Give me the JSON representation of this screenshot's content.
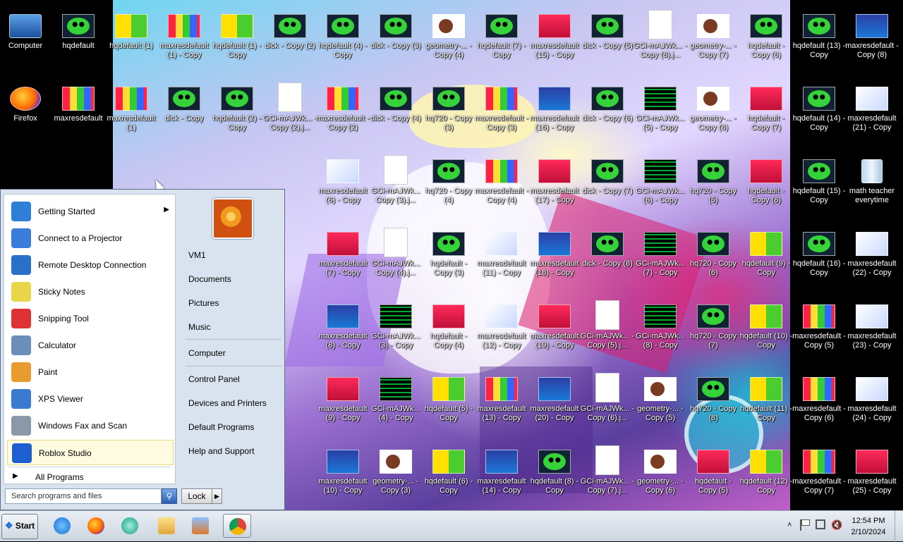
{
  "desktop_icons": [
    {
      "label": "Computer",
      "kind": "computer"
    },
    {
      "label": "hqdefault",
      "kind": "green"
    },
    {
      "label": "hqdefault (1)",
      "kind": "yellow"
    },
    {
      "label": "maxresdefault (1) - Copy",
      "kind": "multi"
    },
    {
      "label": "hqdefault (1) - Copy",
      "kind": "yellow"
    },
    {
      "label": "dick - Copy (2)",
      "kind": "green"
    },
    {
      "label": "hqdefault (4) - Copy",
      "kind": "green"
    },
    {
      "label": "dick - Copy (3)",
      "kind": "green"
    },
    {
      "label": "geometry-... - Copy (4)",
      "kind": "heart"
    },
    {
      "label": "hqdefault (7) - Copy",
      "kind": "green"
    },
    {
      "label": "maxresdefault (15) - Copy",
      "kind": "red"
    },
    {
      "label": "dick - Copy (5)",
      "kind": "green"
    },
    {
      "label": "GCi-mAJWk... - Copy (8).j...",
      "kind": "doc"
    },
    {
      "label": "geometry-... - Copy (7)",
      "kind": "heart"
    },
    {
      "label": "hqdefault - Copy (6)",
      "kind": "green"
    },
    {
      "label": "hqdefault (13) - Copy",
      "kind": "green"
    },
    {
      "label": "maxresdefault - Copy (8)",
      "kind": "blue"
    },
    {
      "label": "Firefox",
      "kind": "firefox"
    },
    {
      "label": "maxresdefault",
      "kind": "multi"
    },
    {
      "label": "maxresdefault (1)",
      "kind": "multi"
    },
    {
      "label": "dick - Copy",
      "kind": "green"
    },
    {
      "label": "hqdefault (2) - Copy",
      "kind": "green"
    },
    {
      "label": "GCi-mAJWk... - Copy (2).j...",
      "kind": "doc"
    },
    {
      "label": "maxresdefault - Copy (2)",
      "kind": "multi"
    },
    {
      "label": "dick - Copy (4)",
      "kind": "green"
    },
    {
      "label": "hq720 - Copy (3)",
      "kind": "green"
    },
    {
      "label": "maxresdefault - Copy (3)",
      "kind": "multi"
    },
    {
      "label": "maxresdefault (16) - Copy",
      "kind": "blue"
    },
    {
      "label": "dick - Copy (6)",
      "kind": "green"
    },
    {
      "label": "GCi-mAJWk... (5) - Copy",
      "kind": "dark"
    },
    {
      "label": "geometry-... - Copy (8)",
      "kind": "heart"
    },
    {
      "label": "hqdefault - Copy (7)",
      "kind": "red"
    },
    {
      "label": "hqdefault (14) - Copy",
      "kind": "green"
    },
    {
      "label": "maxresdefault (21) - Copy",
      "kind": "white"
    },
    {
      "label": "maxresdefault (6) - Copy",
      "kind": "white"
    },
    {
      "label": "GCi-mAJWk... Copy (3).j...",
      "kind": "doc"
    },
    {
      "label": "hq720 - Copy (4)",
      "kind": "green"
    },
    {
      "label": "maxresdefault - Copy (4)",
      "kind": "multi"
    },
    {
      "label": "maxresdefault (17) - Copy",
      "kind": "red"
    },
    {
      "label": "dick - Copy (7)",
      "kind": "green"
    },
    {
      "label": "GCi-mAJWk... (6) - Copy",
      "kind": "dark"
    },
    {
      "label": "hq720 - Copy (5)",
      "kind": "green"
    },
    {
      "label": "hqdefault - Copy (8)",
      "kind": "red"
    },
    {
      "label": "hqdefault (15) - Copy",
      "kind": "green"
    },
    {
      "label": "math teacher everytime",
      "kind": "recycle"
    },
    {
      "label": "maxresdefault (7) - Copy",
      "kind": "red"
    },
    {
      "label": "GCi-mAJWk... Copy (4).j...",
      "kind": "doc"
    },
    {
      "label": "hqdefault - Copy (3)",
      "kind": "green"
    },
    {
      "label": "maxresdefault (11) - Copy",
      "kind": "white"
    },
    {
      "label": "maxresdefault (18) - Copy",
      "kind": "blue"
    },
    {
      "label": "dick - Copy (8)",
      "kind": "green"
    },
    {
      "label": "GCi-mAJWk... (7) - Copy",
      "kind": "dark"
    },
    {
      "label": "hq720 - Copy (6)",
      "kind": "green"
    },
    {
      "label": "hqdefault (9) - Copy",
      "kind": "yellow"
    },
    {
      "label": "hqdefault (16) - Copy",
      "kind": "green"
    },
    {
      "label": "maxresdefault (22) - Copy",
      "kind": "white"
    },
    {
      "label": "maxresdefault (8) - Copy",
      "kind": "blue"
    },
    {
      "label": "GCi-mAJWk... (3) - Copy",
      "kind": "dark"
    },
    {
      "label": "hqdefault - Copy (4)",
      "kind": "red"
    },
    {
      "label": "maxresdefault (12) - Copy",
      "kind": "white"
    },
    {
      "label": "maxresdefault (19) - Copy",
      "kind": "red"
    },
    {
      "label": "GCi-mAJWk... - Copy (5).j...",
      "kind": "doc"
    },
    {
      "label": "GCi-mAJWk... (8) - Copy",
      "kind": "dark"
    },
    {
      "label": "hq720 - Copy (7)",
      "kind": "green"
    },
    {
      "label": "hqdefault (10) - Copy",
      "kind": "yellow"
    },
    {
      "label": "maxresdefault - Copy (5)",
      "kind": "multi"
    },
    {
      "label": "maxresdefault (23) - Copy",
      "kind": "white"
    },
    {
      "label": "maxresdefault (9) - Copy",
      "kind": "red"
    },
    {
      "label": "GCi-mAJWk... (4) - Copy",
      "kind": "dark"
    },
    {
      "label": "hqdefault (5) - Copy",
      "kind": "yellow"
    },
    {
      "label": "maxresdefault (13) - Copy",
      "kind": "multi"
    },
    {
      "label": "maxresdefault (20) - Copy",
      "kind": "blue"
    },
    {
      "label": "GCi-mAJWk... - Copy (6).j...",
      "kind": "doc"
    },
    {
      "label": "geometry-... - Copy (5)",
      "kind": "heart"
    },
    {
      "label": "hq720 - Copy (8)",
      "kind": "green"
    },
    {
      "label": "hqdefault (11) - Copy",
      "kind": "yellow"
    },
    {
      "label": "maxresdefault - Copy (6)",
      "kind": "multi"
    },
    {
      "label": "maxresdefault (24) - Copy",
      "kind": "white"
    },
    {
      "label": "maxresdefault (10) - Copy",
      "kind": "blue"
    },
    {
      "label": "geometry-... - Copy (3)",
      "kind": "heart"
    },
    {
      "label": "hqdefault (6) - Copy",
      "kind": "yellow"
    },
    {
      "label": "maxresdefault (14) - Copy",
      "kind": "blue"
    },
    {
      "label": "hqdefault (8) - Copy",
      "kind": "green"
    },
    {
      "label": "GCi-mAJWk... - Copy (7).j...",
      "kind": "doc"
    },
    {
      "label": "geometry-... - Copy (6)",
      "kind": "heart"
    },
    {
      "label": "hqdefault - Copy (5)",
      "kind": "red"
    },
    {
      "label": "hqdefault (12) - Copy",
      "kind": "yellow"
    },
    {
      "label": "maxresdefault - Copy (7)",
      "kind": "multi"
    },
    {
      "label": "maxresdefault (25) - Copy",
      "kind": "red"
    }
  ],
  "start_menu": {
    "programs": [
      {
        "label": "Getting Started",
        "icon": "getting-started-icon",
        "has_submenu": true
      },
      {
        "label": "Connect to a Projector",
        "icon": "projector-icon"
      },
      {
        "label": "Remote Desktop Connection",
        "icon": "remote-desktop-icon"
      },
      {
        "label": "Sticky Notes",
        "icon": "sticky-notes-icon"
      },
      {
        "label": "Snipping Tool",
        "icon": "snipping-tool-icon"
      },
      {
        "label": "Calculator",
        "icon": "calculator-icon"
      },
      {
        "label": "Paint",
        "icon": "paint-icon"
      },
      {
        "label": "XPS Viewer",
        "icon": "xps-viewer-icon"
      },
      {
        "label": "Windows Fax and Scan",
        "icon": "fax-scan-icon"
      },
      {
        "label": "Roblox Studio",
        "icon": "roblox-studio-icon",
        "highlighted": true
      }
    ],
    "all_programs": "All Programs",
    "search_placeholder": "Search programs and files",
    "lock_label": "Lock",
    "right_group1": [
      "VM1",
      "Documents",
      "Pictures",
      "Music"
    ],
    "right_group2": [
      "Computer"
    ],
    "right_group3": [
      "Control Panel",
      "Devices and Printers",
      "Default Programs",
      "Help and Support"
    ]
  },
  "taskbar": {
    "start_label": "Start",
    "pinned": [
      "internet-explorer-icon",
      "firefox-icon",
      "edge-swirl-icon",
      "file-explorer-icon",
      "media-player-icon",
      "chrome-icon"
    ],
    "time": "12:54 PM",
    "date": "2/10/2024"
  }
}
